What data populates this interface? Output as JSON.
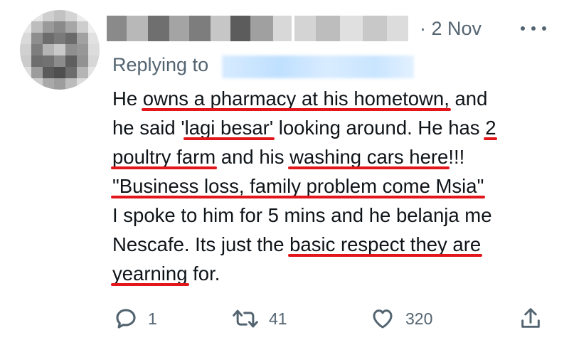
{
  "tweet": {
    "date": "· 2 Nov",
    "replying_to_label": "Replying to",
    "text_lines": [
      {
        "segments": [
          {
            "t": "He ",
            "u": false
          },
          {
            "t": "owns a pharmacy at his hometown,",
            "u": true
          },
          {
            "t": " and",
            "u": false
          }
        ]
      },
      {
        "segments": [
          {
            "t": "he said '",
            "u": false
          },
          {
            "t": "lagi besar'",
            "u": true
          },
          {
            "t": " looking around. He has ",
            "u": false
          },
          {
            "t": "2",
            "u": true
          }
        ]
      },
      {
        "segments": [
          {
            "t": "poultry farm",
            "u": true
          },
          {
            "t": " and his ",
            "u": false
          },
          {
            "t": "washing cars here",
            "u": true
          },
          {
            "t": "!!!",
            "u": false
          }
        ]
      },
      {
        "segments": [
          {
            "t": "\"Business loss, family problem come Msia\"",
            "u": true
          }
        ]
      },
      {
        "segments": [
          {
            "t": "I spoke to him for 5 mins and he belanja me",
            "u": false
          }
        ]
      },
      {
        "segments": [
          {
            "t": "Nescafe. Its just the ",
            "u": false
          },
          {
            "t": "basic respect they are",
            "u": true
          }
        ]
      },
      {
        "segments": [
          {
            "t": "yearning",
            "u": true
          },
          {
            "t": " for.",
            "u": false
          }
        ]
      }
    ],
    "actions": {
      "reply_count": "1",
      "retweet_count": "41",
      "like_count": "320"
    },
    "icons": {
      "reply": "reply-icon",
      "retweet": "retweet-icon",
      "like": "heart-icon",
      "share": "share-icon",
      "more": "more-icon"
    },
    "colors": {
      "text": "#0f1419",
      "secondary": "#536471",
      "underline": "#e3161b"
    }
  }
}
